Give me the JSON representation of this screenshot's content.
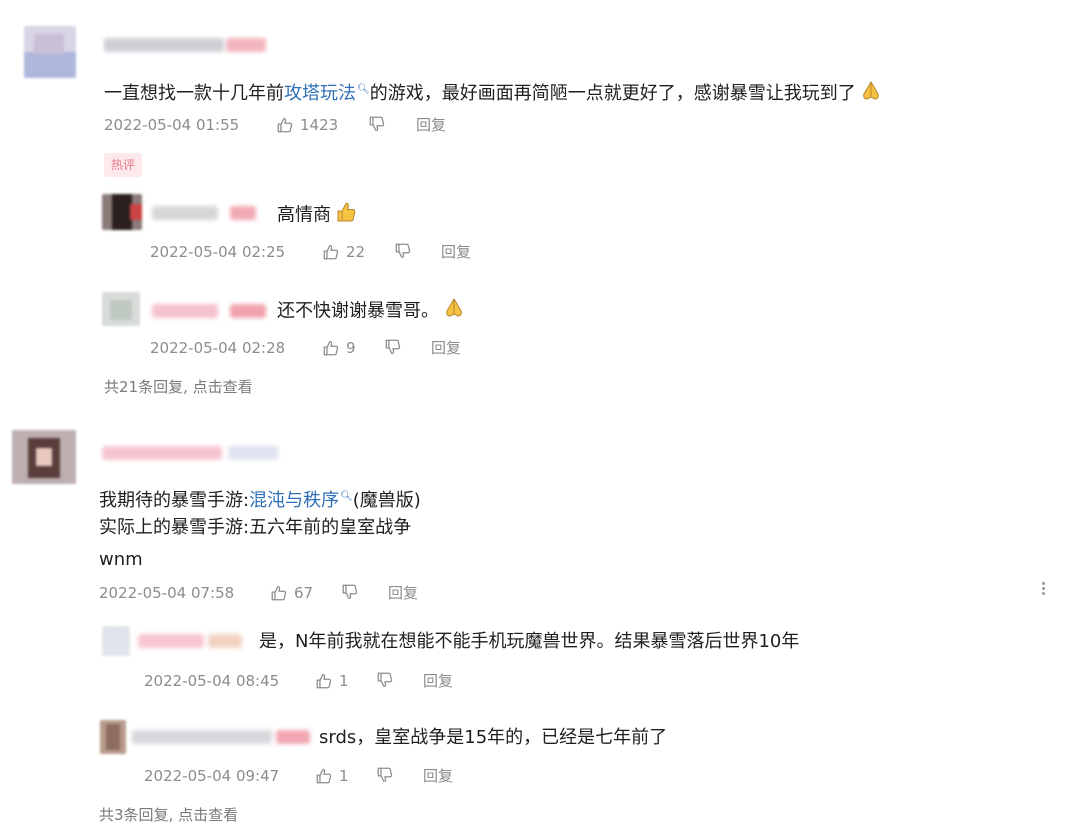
{
  "comments": [
    {
      "text_before": "一直想找一款十几年前",
      "link": "攻塔玩法",
      "text_after": "的游戏，最好画面再简陋一点就更好了，感谢暴雪让我玩到了",
      "time": "2022-05-04 01:55",
      "likes": "1423",
      "reply_label": "回复",
      "badge": "热评",
      "replies": [
        {
          "text": "高情商",
          "time": "2022-05-04 02:25",
          "likes": "22",
          "reply_label": "回复"
        },
        {
          "text": "还不快谢谢暴雪哥。",
          "time": "2022-05-04 02:28",
          "likes": "9",
          "reply_label": "回复"
        }
      ],
      "more_replies": "共21条回复, 点击查看"
    },
    {
      "line1_before": "我期待的暴雪手游:",
      "link": "混沌与秩序",
      "line1_after": "(魔兽版)",
      "line2": "实际上的暴雪手游:五六年前的皇室战争",
      "line3": "wnm",
      "time": "2022-05-04 07:58",
      "likes": "67",
      "reply_label": "回复",
      "replies": [
        {
          "text": "是，N年前我就在想能不能手机玩魔兽世界。结果暴雪落后世界10年",
          "time": "2022-05-04 08:45",
          "likes": "1",
          "reply_label": "回复"
        },
        {
          "text": "srds，皇室战争是15年的，已经是七年前了",
          "time": "2022-05-04 09:47",
          "likes": "1",
          "reply_label": "回复"
        }
      ],
      "more_replies": "共3条回复, 点击查看"
    }
  ],
  "colors": {
    "link": "#2e6fb7",
    "meta": "#8c8c8c",
    "badge_bg": "#fde8ec",
    "badge_text": "#e67a8b"
  },
  "icons": [
    "thumbs-up-icon",
    "thumbs-down-icon",
    "search-hint-icon",
    "folded-hands-emoji",
    "thumbs-up-emoji",
    "more-icon"
  ]
}
